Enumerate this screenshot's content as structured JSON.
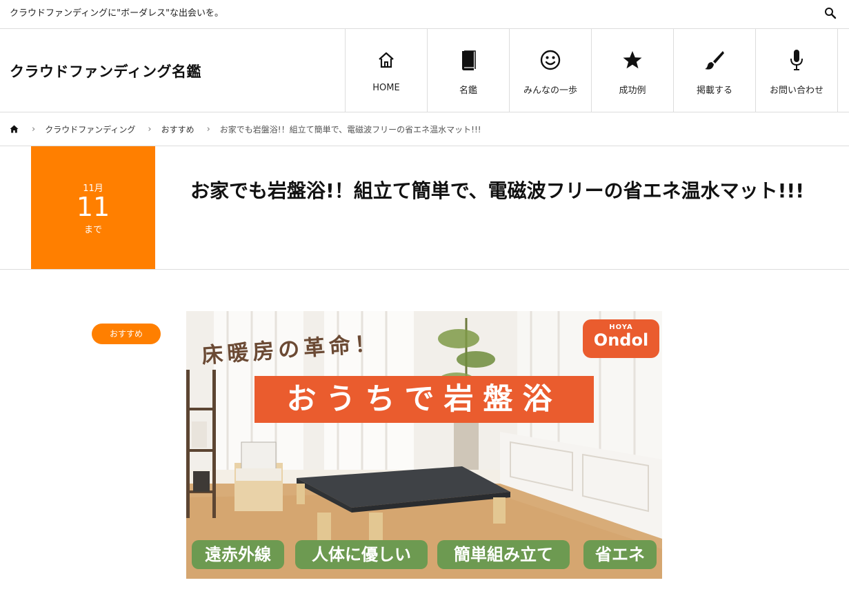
{
  "topbar": {
    "tagline": "クラウドファンディングに\"ボーダレス\"な出会いを。",
    "search_icon": "search-icon"
  },
  "header": {
    "site_title": "クラウドファンディング名鑑",
    "nav": [
      {
        "label": "HOME",
        "icon": "home-icon"
      },
      {
        "label": "名鑑",
        "icon": "book-icon"
      },
      {
        "label": "みんなの一歩",
        "icon": "smiley-icon"
      },
      {
        "label": "成功例",
        "icon": "star-icon"
      },
      {
        "label": "掲載する",
        "icon": "brush-icon"
      },
      {
        "label": "お問い合わせ",
        "icon": "microphone-icon"
      }
    ]
  },
  "breadcrumb": {
    "home_icon": "home-icon",
    "items": [
      "クラウドファンディング",
      "おすすめ"
    ],
    "current": "お家でも岩盤浴!！組立て簡単で、電磁波フリーの省エネ温水マット!!!"
  },
  "post": {
    "date_month": "11月",
    "date_day": "11",
    "date_suffix": "まで",
    "title": "お家でも岩盤浴!！組立て簡単で、電磁波フリーの省エネ温水マット!!!",
    "category": "おすすめ"
  },
  "hero": {
    "tagline": "床暖房の革命！",
    "banner": "おうちで岩盤浴",
    "logo_top": "HOYA",
    "logo_main": "Ondol",
    "features": [
      "遠赤外線",
      "人体に優しい",
      "簡単組み立て",
      "省エネ"
    ]
  },
  "colors": {
    "accent": "#ff7f00",
    "banner": "#ea5c2e",
    "feature": "#6d9a51",
    "border": "#dcdcdc"
  }
}
